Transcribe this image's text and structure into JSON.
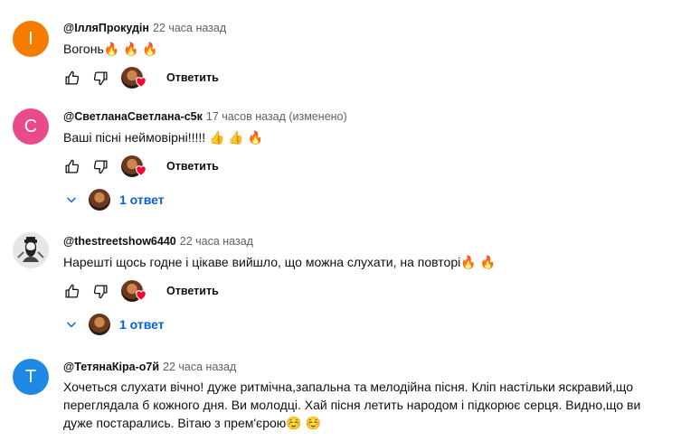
{
  "comments": [
    {
      "avatar_letter": "I",
      "avatar_color": "#f57c00",
      "author": "@ІлляПрокудін",
      "time": "22 часа назад",
      "edited": "",
      "text": "Вогонь🔥 🔥 🔥",
      "reply_label": "Ответить",
      "replies_label": ""
    },
    {
      "avatar_letter": "C",
      "avatar_color": "#e84a8a",
      "author": "@СветланаСветлана-с5к",
      "time": "17 часов назад",
      "edited": "(изменено)",
      "text": "Ваші пісні неймовірні!!!!! 👍 👍 🔥",
      "reply_label": "Ответить",
      "replies_label": "1 ответ"
    },
    {
      "avatar_letter": "",
      "avatar_color": "#e8e8e8",
      "author": "@thestreetshow6440",
      "time": "22 часа назад",
      "edited": "",
      "text": "Нарешті щось годне і цікаве вийшло, що можна слухати, на повторі🔥 🔥",
      "reply_label": "Ответить",
      "replies_label": "1 ответ"
    },
    {
      "avatar_letter": "T",
      "avatar_color": "#1e88e5",
      "author": "@ТетянаКіра-о7й",
      "time": "22 часа назад",
      "edited": "",
      "text": "Хочеться слухати вічно! дуже ритмічна,запальна та мелодійна пісня. Кліп настільки яскравий,що переглядала б кожного дня. Ви молодці. Хай пісня летить народом і підкорює серця. Видно,що ви дуже постарались. Вітаю з прем'єрою☺️ ☺️",
      "reply_label": "",
      "replies_label": ""
    }
  ]
}
